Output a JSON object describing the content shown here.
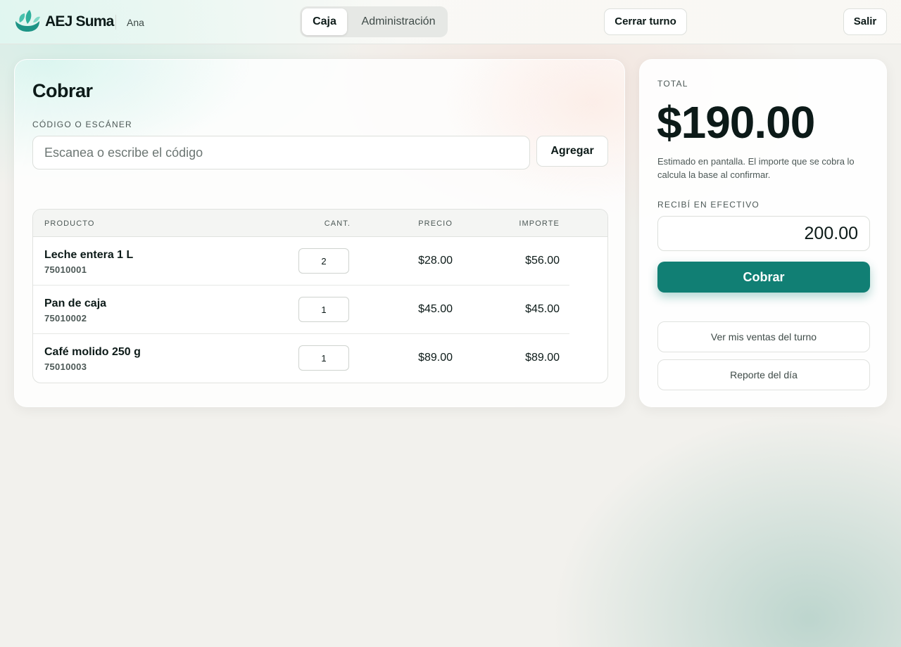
{
  "header": {
    "brand": "AEJ Suma",
    "user": "Ana",
    "tabs": [
      {
        "label": "Caja",
        "active": true
      },
      {
        "label": "Administración",
        "active": false
      }
    ],
    "close_shift_label": "Cerrar turno",
    "logout_label": "Salir",
    "logo_icon": "leaf-bowl-icon",
    "accent_color": "#117f74"
  },
  "charge": {
    "title": "Cobrar",
    "code_label": "CÓDIGO O ESCÁNER",
    "code_placeholder": "Escanea o escribe el código",
    "code_value": "",
    "add_label": "Agregar",
    "table": {
      "headers": {
        "product": "PRODUCTO",
        "qty": "CANT.",
        "price": "PRECIO",
        "amount": "IMPORTE"
      },
      "rows": [
        {
          "name": "Leche entera 1 L",
          "code": "75010001",
          "qty": "2",
          "price": "$28.00",
          "amount": "$56.00"
        },
        {
          "name": "Pan de caja",
          "code": "75010002",
          "qty": "1",
          "price": "$45.00",
          "amount": "$45.00"
        },
        {
          "name": "Café molido 250 g",
          "code": "75010003",
          "qty": "1",
          "price": "$89.00",
          "amount": "$89.00"
        }
      ]
    }
  },
  "summary": {
    "total_label": "TOTAL",
    "total_amount": "$190.00",
    "note": "Estimado en pantalla. El importe que se cobra lo calcula la base al confirmar.",
    "cash_label": "RECIBÍ EN EFECTIVO",
    "cash_value": "200.00",
    "charge_button": "Cobrar",
    "shift_sales_button": "Ver mis ventas del turno",
    "daily_report_button": "Reporte del día"
  }
}
